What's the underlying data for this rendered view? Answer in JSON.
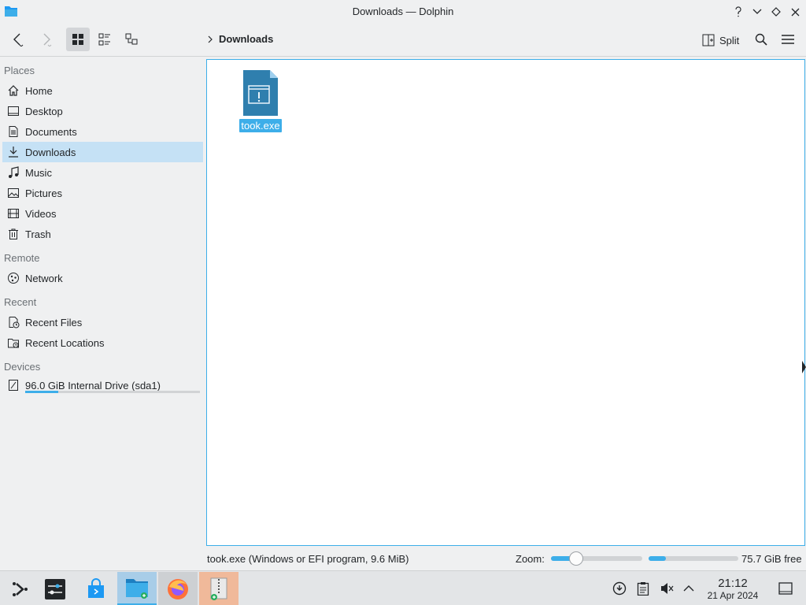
{
  "window": {
    "title": "Downloads — Dolphin",
    "buttons": [
      "help",
      "minimize",
      "maximize",
      "close"
    ]
  },
  "toolbar": {
    "back_icon": "chevron-left-icon",
    "forward_icon": "chevron-right-icon",
    "view_modes": [
      "icons",
      "compact",
      "details"
    ],
    "active_view": "icons",
    "breadcrumb": "Downloads",
    "split_label": "Split"
  },
  "sidebar": {
    "places_title": "Places",
    "places": [
      {
        "label": "Home",
        "icon": "home-icon"
      },
      {
        "label": "Desktop",
        "icon": "desktop-icon"
      },
      {
        "label": "Documents",
        "icon": "documents-icon"
      },
      {
        "label": "Downloads",
        "icon": "download-icon",
        "selected": true
      },
      {
        "label": "Music",
        "icon": "music-icon"
      },
      {
        "label": "Pictures",
        "icon": "pictures-icon"
      },
      {
        "label": "Videos",
        "icon": "videos-icon"
      },
      {
        "label": "Trash",
        "icon": "trash-icon"
      }
    ],
    "remote_title": "Remote",
    "remote": [
      {
        "label": "Network",
        "icon": "network-icon"
      }
    ],
    "recent_title": "Recent",
    "recent": [
      {
        "label": "Recent Files",
        "icon": "recent-files-icon"
      },
      {
        "label": "Recent Locations",
        "icon": "recent-locations-icon"
      }
    ],
    "devices_title": "Devices",
    "devices": [
      {
        "label": "96.0 GiB Internal Drive (sda1)",
        "icon": "drive-icon",
        "usage_fraction": 0.19
      }
    ]
  },
  "files": [
    {
      "name": "took.exe",
      "icon": "executable-file-icon",
      "selected": true
    }
  ],
  "statusbar": {
    "status_text": "took.exe (Windows or EFI program, 9.6 MiB)",
    "zoom_label": "Zoom:",
    "zoom_fraction": 0.28,
    "space_used_fraction": 0.19,
    "free_text": "75.7 GiB free"
  },
  "taskbar": {
    "apps": [
      {
        "name": "application-launcher",
        "icon": "launcher-icon"
      },
      {
        "name": "system-settings",
        "icon": "settings-icon"
      },
      {
        "name": "discover",
        "icon": "store-icon"
      },
      {
        "name": "dolphin",
        "icon": "folder-icon",
        "state": "active"
      },
      {
        "name": "firefox",
        "icon": "firefox-icon",
        "state": "open"
      },
      {
        "name": "ark",
        "icon": "archive-icon",
        "state": "highlighted"
      }
    ],
    "tray": [
      "updates-icon",
      "clipboard-icon",
      "volume-muted-icon",
      "tray-expand-icon"
    ],
    "clock": {
      "time": "21:12",
      "date": "21 Apr 2024"
    },
    "show_desktop_icon": "show-desktop-icon",
    "colors": {
      "accent": "#3daee9",
      "selection": "#c5e1f5",
      "orange": "#f0b99a"
    }
  }
}
